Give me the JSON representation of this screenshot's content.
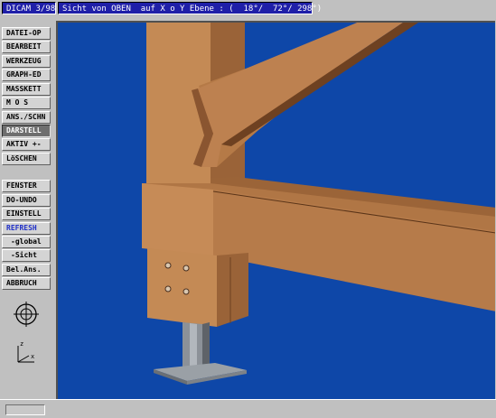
{
  "titlebar": {
    "app_version": "DICAM 3/98",
    "view_info": "Sicht von OBEN  auf X o Y Ebene : (  18°/  72°/ 298°)"
  },
  "sidebar": {
    "items": [
      {
        "label": "DATEI-OP",
        "state": "normal"
      },
      {
        "label": "BEARBEIT",
        "state": "normal"
      },
      {
        "label": "WERKZEUG",
        "state": "normal"
      },
      {
        "label": "GRAPH-ED",
        "state": "normal"
      },
      {
        "label": "MASSKETT",
        "state": "normal"
      },
      {
        "label": "M O S",
        "state": "normal"
      },
      {
        "label": "ANS./SCHN",
        "state": "normal"
      },
      {
        "label": "DARSTELL",
        "state": "active"
      },
      {
        "label": "AKTIV +-",
        "state": "normal"
      },
      {
        "label": "LöSCHEN",
        "state": "normal"
      },
      {
        "label": "FENSTER",
        "state": "normal"
      },
      {
        "label": "DO-UNDO",
        "state": "normal"
      },
      {
        "label": "EINSTELL",
        "state": "normal"
      },
      {
        "label": "REFRESH",
        "state": "blue"
      },
      {
        "label": "-global",
        "state": "sub"
      },
      {
        "label": "-Sicht",
        "state": "sub"
      },
      {
        "label": "Bel.Ans.",
        "state": "normal"
      },
      {
        "label": "ABBRUCH",
        "state": "normal"
      }
    ],
    "axis_labels": {
      "z": "z",
      "x": "x"
    }
  },
  "icons": {
    "compass": "crosshair-circle-icon",
    "axis": "axis-triad-icon"
  },
  "colors": {
    "viewport_bg": "#0e47a8",
    "wood_light": "#c58a55",
    "wood_mid": "#a56d3f",
    "wood_dark": "#6e4121",
    "steel": "#8a8f96",
    "active_menu": "#6e6e6e",
    "title_bg": "#1f1fa8"
  },
  "statusbar": {
    "text": ""
  }
}
